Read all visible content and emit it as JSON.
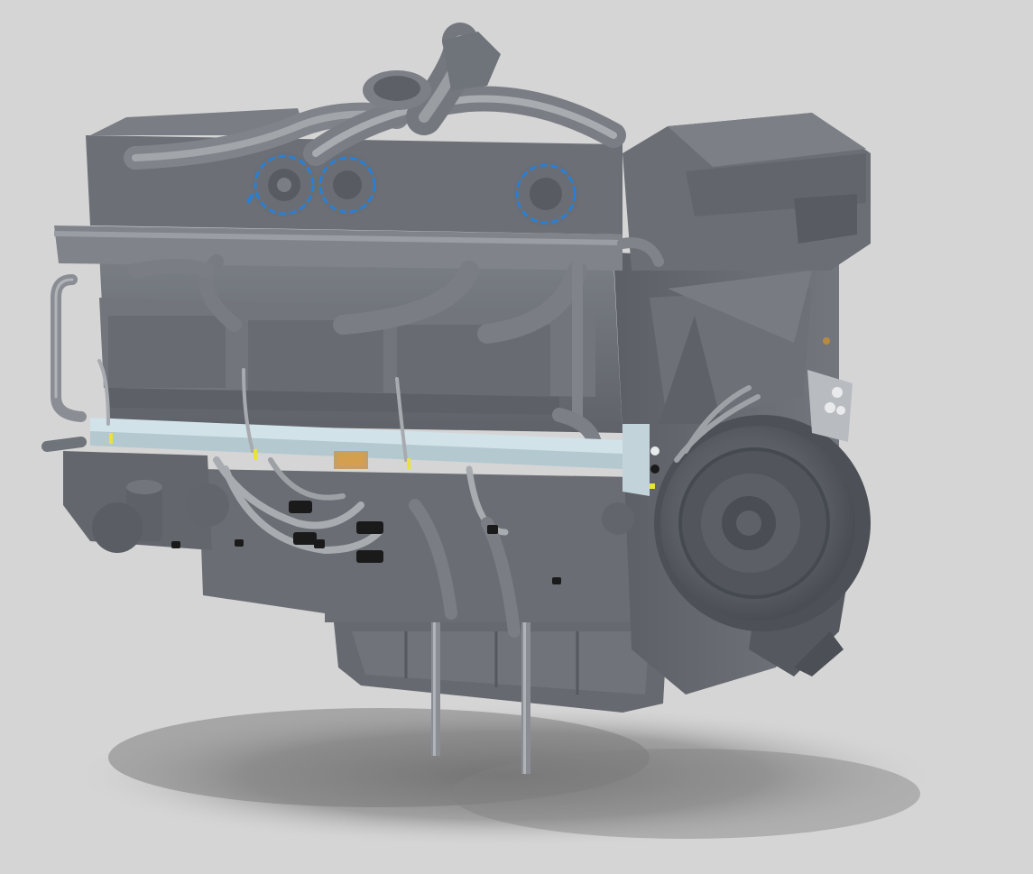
{
  "scene": {
    "background_color": "#d5d5d5",
    "model": "engine-cad-model",
    "colors": {
      "metal_base": "#6f737a",
      "metal_dark": "#50545a",
      "metal_light": "#9a9ea4",
      "metal_highlight": "#c3c7cc",
      "rail_color": "#cfdfe6",
      "accent_blue": "#2a7fd4",
      "accent_yellow": "#e8e23a",
      "accent_orange": "#e0a040",
      "connector_black": "#1a1a1a",
      "shadow_color": "#6e6e6e"
    }
  }
}
